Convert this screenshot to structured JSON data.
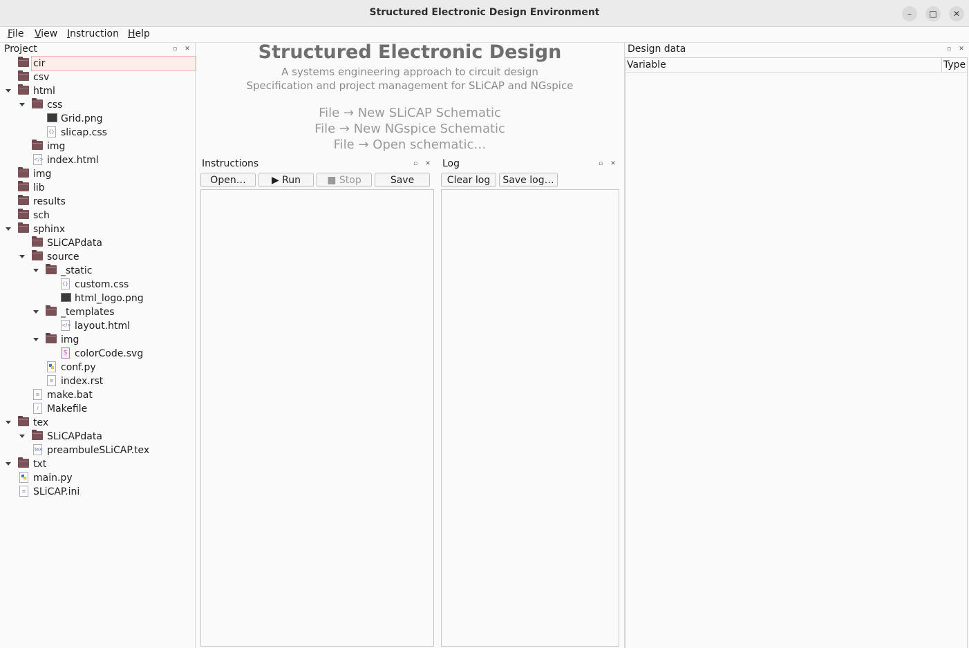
{
  "window": {
    "title": "Structured Electronic Design Environment",
    "minimize": "–",
    "maximize": "□",
    "close": "✕"
  },
  "menu": {
    "file": {
      "mnemonic": "F",
      "rest": "ile"
    },
    "view": {
      "mnemonic": "V",
      "rest": "iew"
    },
    "instruction": {
      "mnemonic": "I",
      "rest": "nstruction"
    },
    "help": {
      "mnemonic": "H",
      "rest": "elp"
    }
  },
  "project": {
    "title": "Project",
    "tree": [
      {
        "label": "cir",
        "icon": "folder-icon",
        "expanded": false,
        "selected": true
      },
      {
        "label": "csv",
        "icon": "folder-icon",
        "expanded": false
      },
      {
        "label": "html",
        "icon": "folder-icon",
        "expanded": true
      },
      {
        "label": "css",
        "icon": "folder-icon",
        "expanded": true
      },
      {
        "label": "Grid.png",
        "icon": "image-file-icon"
      },
      {
        "label": "slicap.css",
        "icon": "css-file-icon"
      },
      {
        "label": "img",
        "icon": "folder-icon",
        "expanded": false
      },
      {
        "label": "index.html",
        "icon": "html-file-icon"
      },
      {
        "label": "img",
        "icon": "folder-icon",
        "expanded": false
      },
      {
        "label": "lib",
        "icon": "folder-icon",
        "expanded": false
      },
      {
        "label": "results",
        "icon": "folder-icon",
        "expanded": false
      },
      {
        "label": "sch",
        "icon": "folder-icon",
        "expanded": false
      },
      {
        "label": "sphinx",
        "icon": "folder-icon",
        "expanded": true
      },
      {
        "label": "SLiCAPdata",
        "icon": "folder-icon",
        "expanded": false
      },
      {
        "label": "source",
        "icon": "folder-icon",
        "expanded": true
      },
      {
        "label": "_static",
        "icon": "folder-icon",
        "expanded": true
      },
      {
        "label": "custom.css",
        "icon": "css-file-icon"
      },
      {
        "label": "html_logo.png",
        "icon": "image-file-icon"
      },
      {
        "label": "_templates",
        "icon": "folder-icon",
        "expanded": true
      },
      {
        "label": "layout.html",
        "icon": "html-file-icon"
      },
      {
        "label": "img",
        "icon": "folder-icon",
        "expanded": true
      },
      {
        "label": "colorCode.svg",
        "icon": "svg-file-icon"
      },
      {
        "label": "conf.py",
        "icon": "python-file-icon"
      },
      {
        "label": "index.rst",
        "icon": "text-file-icon"
      },
      {
        "label": "make.bat",
        "icon": "text-file-icon"
      },
      {
        "label": "Makefile",
        "icon": "makefile-icon"
      },
      {
        "label": "tex",
        "icon": "folder-icon",
        "expanded": true
      },
      {
        "label": "SLiCAPdata",
        "icon": "folder-icon",
        "expanded": true
      },
      {
        "label": "preambuleSLiCAP.tex",
        "icon": "tex-file-icon"
      },
      {
        "label": "txt",
        "icon": "folder-icon",
        "expanded": true
      },
      {
        "label": "main.py",
        "icon": "python-file-icon"
      },
      {
        "label": "SLiCAP.ini",
        "icon": "text-file-icon"
      }
    ]
  },
  "welcome": {
    "heading": "Structured Electronic Design",
    "subtitle1": "A systems engineering approach to circuit design",
    "subtitle2": "Specification and project management for SLiCAP and NGspice",
    "hint1": "File → New SLiCAP Schematic",
    "hint2": "File → New NGspice Schematic",
    "hint3": "File → Open schematic…"
  },
  "instructions": {
    "title": "Instructions",
    "open_label": "Open…",
    "run_label": "▶ Run",
    "stop_label": "■ Stop",
    "save_label": "Save"
  },
  "log": {
    "title": "Log",
    "clear_label": "Clear log",
    "save_label": "Save log…"
  },
  "design_data": {
    "title": "Design data",
    "columns": [
      "Variable",
      "Type"
    ]
  },
  "colors": {
    "accent": "#e95420",
    "selection_bg": "#fdeeea",
    "folder": "#7a5157"
  }
}
